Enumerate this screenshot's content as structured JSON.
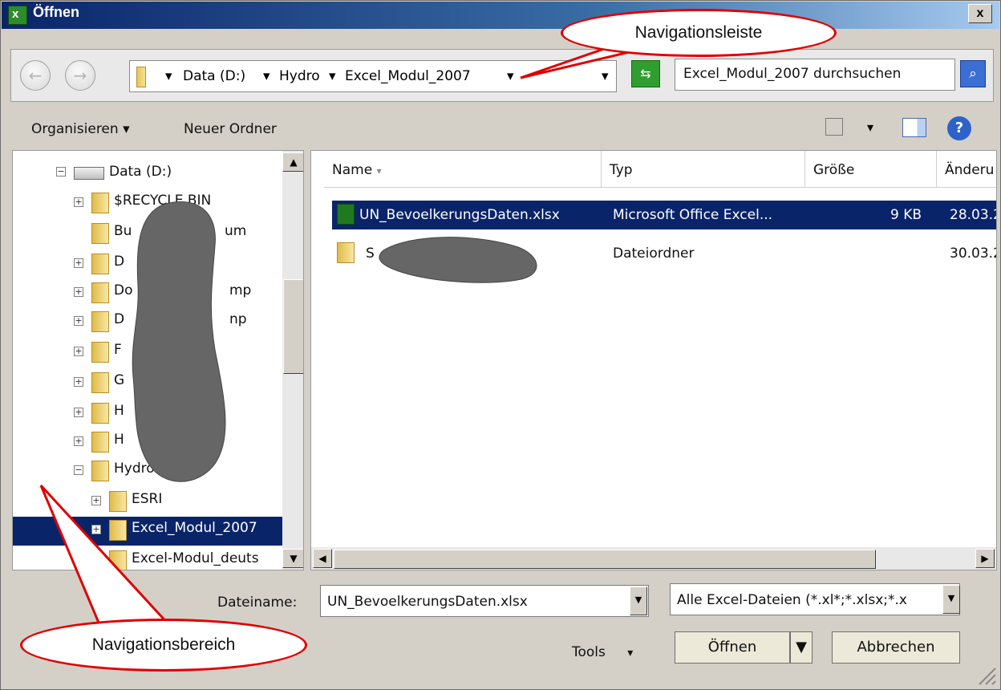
{
  "window": {
    "title": "Öffnen",
    "close_label": "x"
  },
  "navbar": {
    "breadcrumb": [
      "Data (D:)",
      "Hydro",
      "Excel_Modul_2007"
    ],
    "search_placeholder": "Excel_Modul_2007 durchsuchen"
  },
  "toolbar": {
    "organize": "Organisieren",
    "new_folder": "Neuer Ordner"
  },
  "tree": {
    "items": [
      {
        "label": "Data (D:)"
      },
      {
        "label": "$RECYCLE.BIN"
      },
      {
        "label": "Bu"
      },
      {
        "label": "um"
      },
      {
        "label": "D"
      },
      {
        "label": "Do"
      },
      {
        "label": "mp"
      },
      {
        "label": "D"
      },
      {
        "label": "np"
      },
      {
        "label": "F"
      },
      {
        "label": "G"
      },
      {
        "label": "H"
      },
      {
        "label": "H"
      },
      {
        "label": "Hydro"
      },
      {
        "label": "ESRI"
      },
      {
        "label": "Excel_Modul_2007"
      },
      {
        "label": "Excel-Modul_deuts"
      }
    ]
  },
  "files": {
    "columns": [
      "Name",
      "Typ",
      "Größe",
      "Änderu"
    ],
    "rows": [
      {
        "name": "UN_BevoelkerungsDaten.xlsx",
        "type": "Microsoft Office Excel...",
        "size": "9 KB",
        "date": "28.03.2"
      },
      {
        "name": "S",
        "type": "Dateiordner",
        "size": "",
        "date": "30.03.2"
      }
    ]
  },
  "bottom": {
    "filename_label": "Dateiname:",
    "filename_value": "UN_BevoelkerungsDaten.xlsx",
    "filter_value": "Alle Excel-Dateien (*.xl*;*.xlsx;*.x",
    "tools_label": "Tools",
    "open_label": "Öffnen",
    "cancel_label": "Abbrechen"
  },
  "callouts": {
    "nav_bar": "Navigationsleiste",
    "nav_area": "Navigationsbereich"
  }
}
